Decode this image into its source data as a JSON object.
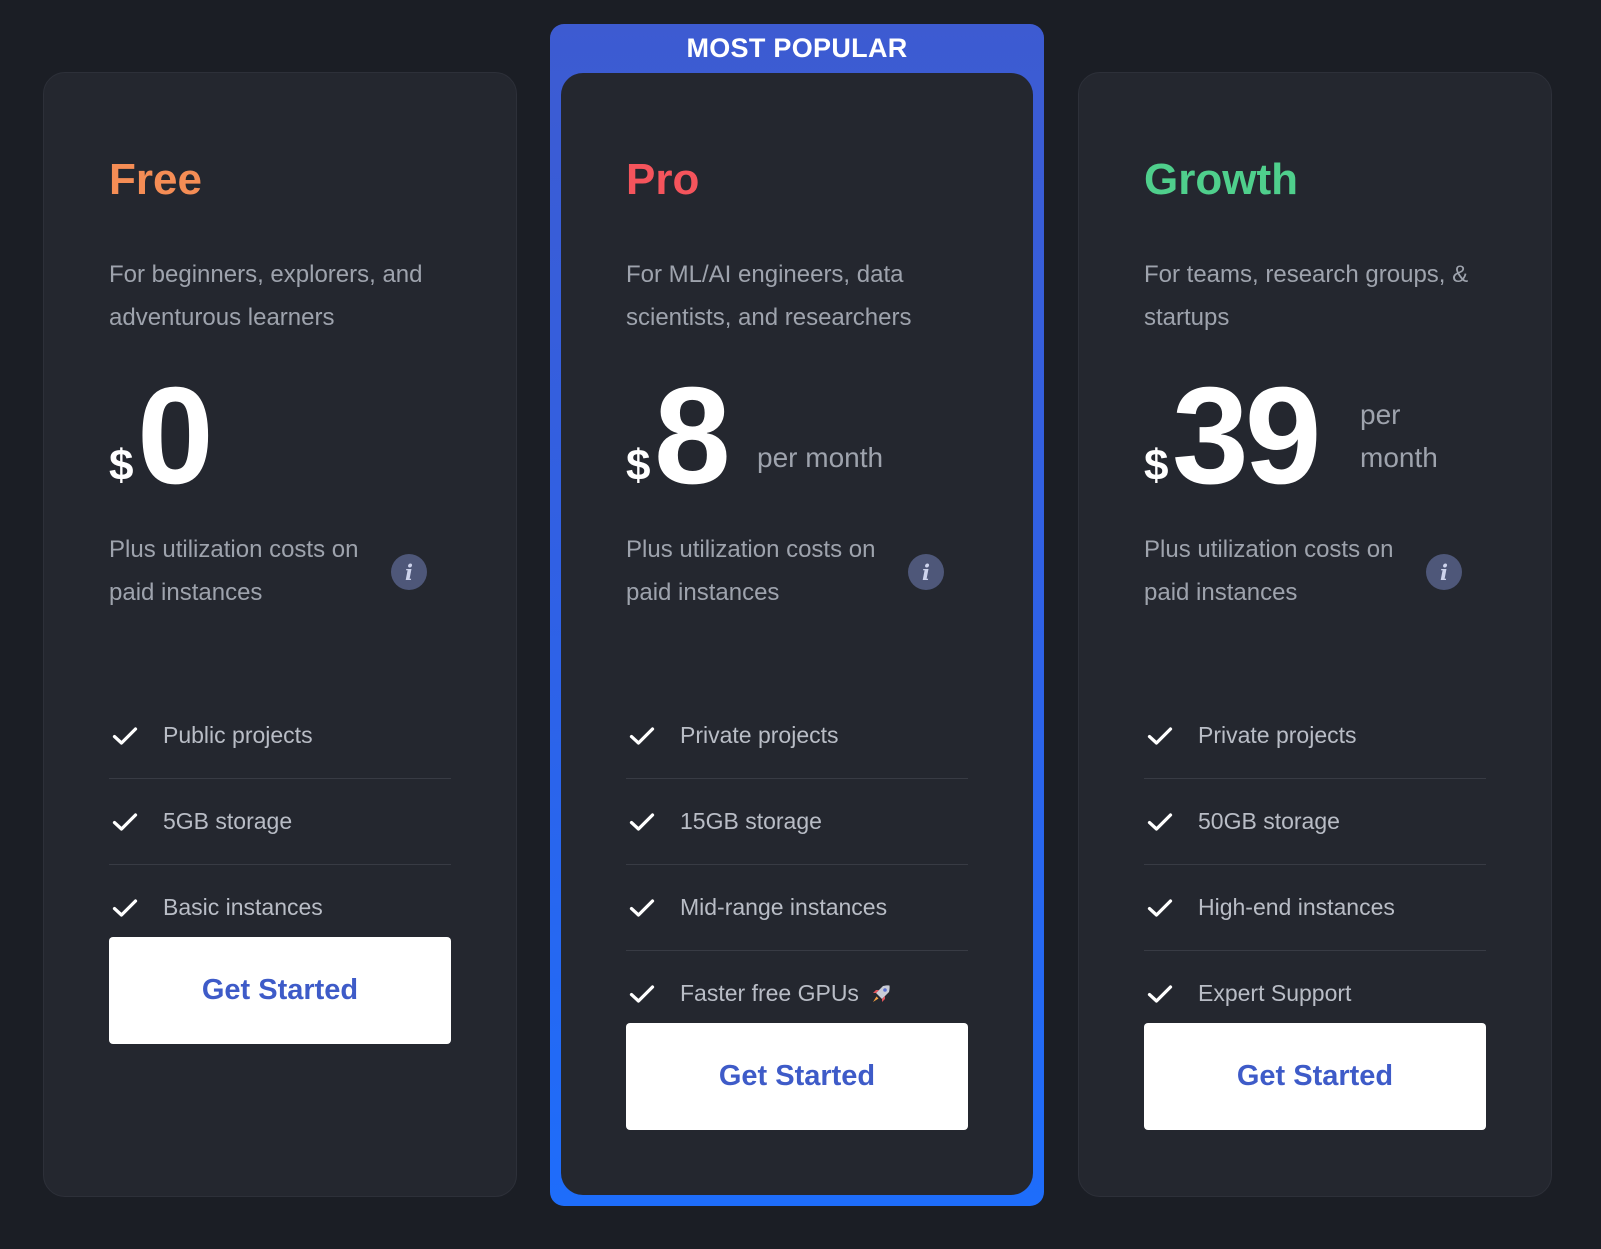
{
  "featured_badge": "MOST POPULAR",
  "colors": {
    "background": "#1b1e25",
    "card": "#24272f",
    "free_accent": "#f58d55",
    "pro_accent": "#f5545c",
    "growth_accent": "#4fcf8c",
    "featured_border_top": "#3d5bd1",
    "featured_border_bottom": "#1e6dfb",
    "cta_text": "#3e5bc8"
  },
  "plans": [
    {
      "name": "Free",
      "description": "For beginners, explorers, and adventurous learners",
      "currency": "$",
      "price": "0",
      "period": "",
      "utilization_note": "Plus utilization costs on paid instances",
      "features": [
        {
          "label": "Public projects"
        },
        {
          "label": "5GB storage"
        },
        {
          "label": "Basic instances"
        }
      ],
      "cta": "Get Started"
    },
    {
      "name": "Pro",
      "description": "For ML/AI engineers, data scientists, and researchers",
      "currency": "$",
      "price": "8",
      "period": "per month",
      "utilization_note": "Plus utilization costs on paid instances",
      "features": [
        {
          "label": "Private projects"
        },
        {
          "label": "15GB storage"
        },
        {
          "label": "Mid-range instances"
        },
        {
          "label": "Faster free GPUs",
          "icon": "rocket-icon"
        }
      ],
      "cta": "Get Started"
    },
    {
      "name": "Growth",
      "description": "For teams, research groups, & startups",
      "currency": "$",
      "price": "39",
      "period": "per month",
      "utilization_note": "Plus utilization costs on paid instances",
      "features": [
        {
          "label": "Private projects"
        },
        {
          "label": "50GB storage"
        },
        {
          "label": "High-end instances"
        },
        {
          "label": "Expert Support"
        }
      ],
      "cta": "Get Started"
    }
  ]
}
